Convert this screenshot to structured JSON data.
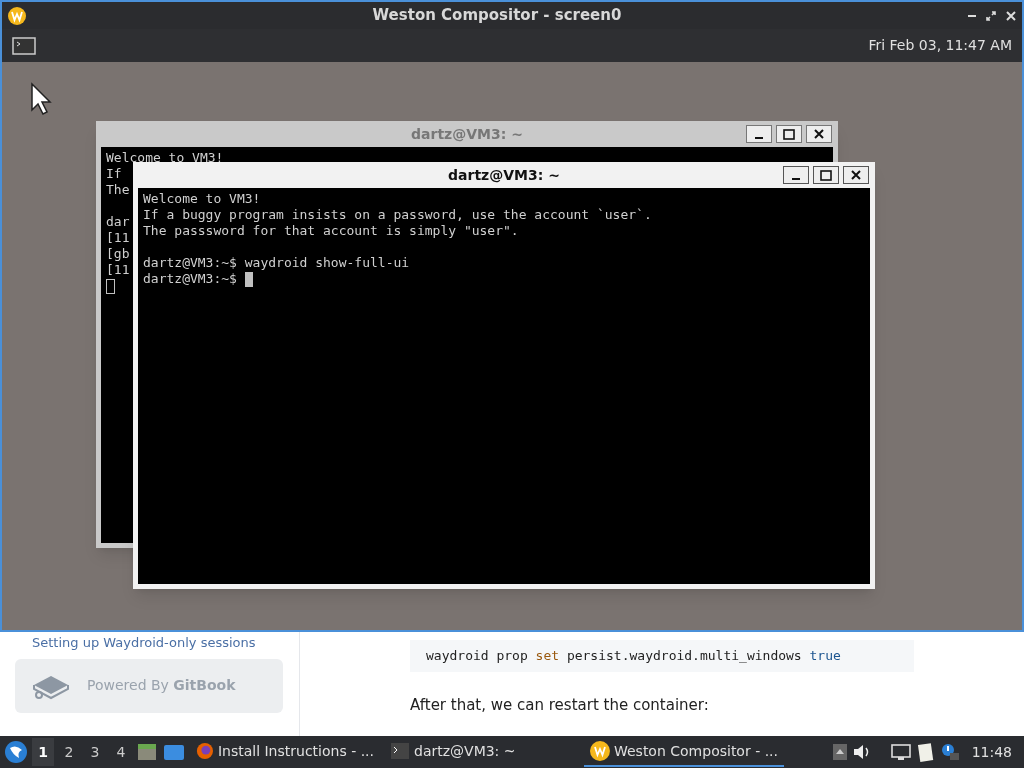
{
  "compositor": {
    "title": "Weston Compositor - screen0",
    "clock": "Fri Feb 03, 11:47 AM"
  },
  "terminals": [
    {
      "title": "dartz@VM3: ~",
      "focused": false,
      "blocks": [
        [
          "Welcome to VM3!",
          "If",
          "The"
        ],
        [
          "dar",
          "[11",
          "[gb",
          "[11"
        ]
      ]
    },
    {
      "title": "dartz@VM3: ~",
      "focused": true,
      "blocks": [
        [
          "Welcome to VM3!",
          "If a buggy program insists on a password, use the account `user`.",
          "The passsword for that account is simply \"user\"."
        ],
        [
          "dartz@VM3:~$ waydroid show-full-ui",
          "dartz@VM3:~$"
        ]
      ]
    }
  ],
  "browser": {
    "sidebar_item": "Setting up Waydroid-only sessions",
    "powered_by": "Powered By **GitBook**",
    "code": [
      {
        "kind": "plain",
        "text": "waydroid prop "
      },
      {
        "kind": "keyword",
        "text": "set"
      },
      {
        "kind": "plain",
        "text": " persist.waydroid.multi_windows "
      },
      {
        "kind": "literal",
        "text": "true"
      }
    ],
    "paragraph": "After that, we can restart the container:"
  },
  "taskbar": {
    "workspaces": [
      {
        "label": "1",
        "selected": true
      },
      {
        "label": "2",
        "selected": false
      },
      {
        "label": "3",
        "selected": false
      },
      {
        "label": "4",
        "selected": false
      }
    ],
    "tasks": [
      {
        "kind": "firefox",
        "label": "Install Instructions - ...",
        "selected": false
      },
      {
        "kind": "terminal",
        "label": "dartz@VM3: ~",
        "selected": false
      },
      {
        "kind": "weston",
        "label": "Weston Compositor - ...",
        "selected": true
      }
    ],
    "clock": "11:48"
  }
}
